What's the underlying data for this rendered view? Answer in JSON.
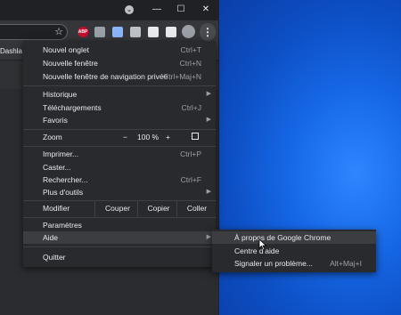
{
  "window": {
    "controls": {
      "dropdown": "⌄",
      "minimize": "—",
      "maximize": "☐",
      "close": "✕"
    }
  },
  "toolbar": {
    "star": "☆",
    "extensions": [
      {
        "name": "abp-extension-icon",
        "label": "ABP",
        "color": "#c70d2c"
      },
      {
        "name": "shield-extension-icon",
        "label": "",
        "color": "#9aa0a6"
      },
      {
        "name": "bar-extension-icon",
        "label": "",
        "color": "#8ab4f8"
      },
      {
        "name": "cloud-extension-icon",
        "label": "",
        "color": "#bdc1c6"
      },
      {
        "name": "eye-extension-icon",
        "label": "",
        "color": "#e8eaed"
      },
      {
        "name": "puzzle-extension-icon",
        "label": "",
        "color": "#e8eaed"
      }
    ],
    "menu_dots": "⋮"
  },
  "bookmarks": {
    "first": "Dashla"
  },
  "menu": {
    "new_tab": {
      "label": "Nouvel onglet",
      "shortcut": "Ctrl+T"
    },
    "new_window": {
      "label": "Nouvelle fenêtre",
      "shortcut": "Ctrl+N"
    },
    "incognito": {
      "label": "Nouvelle fenêtre de navigation privée",
      "shortcut": "Ctrl+Maj+N"
    },
    "history": {
      "label": "Historique"
    },
    "downloads": {
      "label": "Téléchargements",
      "shortcut": "Ctrl+J"
    },
    "bookmarks": {
      "label": "Favoris"
    },
    "zoom": {
      "label": "Zoom",
      "minus": "−",
      "value": "100 %",
      "plus": "+"
    },
    "print": {
      "label": "Imprimer...",
      "shortcut": "Ctrl+P"
    },
    "cast": {
      "label": "Caster..."
    },
    "find": {
      "label": "Rechercher...",
      "shortcut": "Ctrl+F"
    },
    "more_tools": {
      "label": "Plus d'outils"
    },
    "edit": {
      "label": "Modifier",
      "cut": "Couper",
      "copy": "Copier",
      "paste": "Coller"
    },
    "settings": {
      "label": "Paramètres"
    },
    "help": {
      "label": "Aide"
    },
    "quit": {
      "label": "Quitter"
    }
  },
  "help_submenu": {
    "about": {
      "label": "À propos de Google Chrome"
    },
    "help_center": {
      "label": "Centre d'aide"
    },
    "report": {
      "label": "Signaler un problème...",
      "shortcut": "Alt+Maj+I"
    }
  }
}
